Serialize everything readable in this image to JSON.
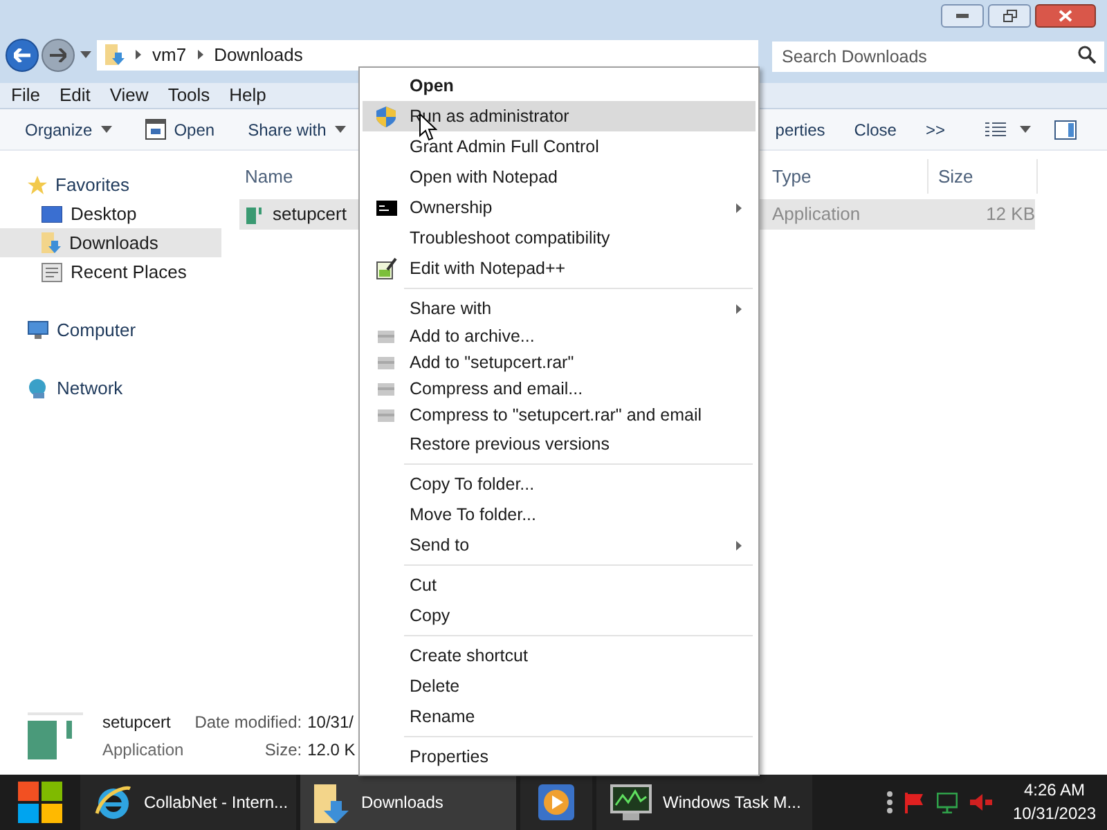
{
  "address_bar": {
    "crumbs": [
      "vm7",
      "Downloads"
    ]
  },
  "search": {
    "placeholder": "Search Downloads"
  },
  "menu_bar": [
    "File",
    "Edit",
    "View",
    "Tools",
    "Help"
  ],
  "toolbar": [
    {
      "label": "Organize",
      "kind": "dropdown"
    },
    {
      "label": "Open",
      "kind": "open"
    },
    {
      "label": "Share with",
      "kind": "dropdown"
    },
    {
      "label": "perties",
      "kind": "plain"
    },
    {
      "label": "Close",
      "kind": "plain"
    },
    {
      "label": ">>",
      "kind": "plain"
    }
  ],
  "sidebar": {
    "items": [
      {
        "label": "Favorites",
        "kind": "star",
        "selected": false
      },
      {
        "label": "Desktop",
        "kind": "desktop",
        "selected": false
      },
      {
        "label": "Downloads",
        "kind": "downloads",
        "selected": true
      },
      {
        "label": "Recent Places",
        "kind": "recent",
        "selected": false
      },
      {
        "label": "Computer",
        "kind": "computer",
        "selected": false
      },
      {
        "label": "Network",
        "kind": "network",
        "selected": false
      }
    ]
  },
  "table": {
    "columns": [
      "Name",
      "Type",
      "Size"
    ],
    "rows": [
      {
        "name": "setupcert",
        "type": "Application",
        "size": "12 KB",
        "selected": true
      }
    ]
  },
  "context_menu": {
    "items": [
      {
        "label": "Open",
        "kind": "default",
        "selected": false,
        "submenu": false
      },
      {
        "label": "Run as administrator",
        "kind": "shield",
        "selected": true,
        "submenu": false
      },
      {
        "label": "Grant Admin Full Control",
        "kind": "plain",
        "selected": false,
        "submenu": false
      },
      {
        "label": "Open with Notepad",
        "kind": "plain",
        "selected": false,
        "submenu": false
      },
      {
        "label": "Ownership",
        "kind": "console",
        "selected": false,
        "submenu": true
      },
      {
        "label": "Troubleshoot compatibility",
        "kind": "plain",
        "selected": false,
        "submenu": false
      },
      {
        "label": "Edit with Notepad++",
        "kind": "notepad",
        "selected": false,
        "submenu": false
      },
      {
        "kind": "separator"
      },
      {
        "label": "Share with",
        "kind": "plain",
        "selected": false,
        "submenu": true
      },
      {
        "label": "Add to archive...",
        "kind": "archive",
        "selected": false,
        "submenu": false
      },
      {
        "label": "Add to \"setupcert.rar\"",
        "kind": "archive",
        "selected": false,
        "submenu": false
      },
      {
        "label": "Compress and email...",
        "kind": "archive",
        "selected": false,
        "submenu": false
      },
      {
        "label": "Compress to \"setupcert.rar\" and email",
        "kind": "archive",
        "selected": false,
        "submenu": false
      },
      {
        "label": "Restore previous versions",
        "kind": "plain",
        "selected": false,
        "submenu": false
      },
      {
        "kind": "separator"
      },
      {
        "label": "Copy To folder...",
        "kind": "plain",
        "selected": false,
        "submenu": false
      },
      {
        "label": "Move To folder...",
        "kind": "plain",
        "selected": false,
        "submenu": false
      },
      {
        "label": "Send to",
        "kind": "plain",
        "selected": false,
        "submenu": true
      },
      {
        "kind": "separator"
      },
      {
        "label": "Cut",
        "kind": "plain",
        "selected": false,
        "submenu": false
      },
      {
        "label": "Copy",
        "kind": "plain",
        "selected": false,
        "submenu": false
      },
      {
        "kind": "separator"
      },
      {
        "label": "Create shortcut",
        "kind": "plain",
        "selected": false,
        "submenu": false
      },
      {
        "label": "Delete",
        "kind": "plain",
        "selected": false,
        "submenu": false
      },
      {
        "label": "Rename",
        "kind": "plain",
        "selected": false,
        "submenu": false
      },
      {
        "kind": "separator"
      },
      {
        "label": "Properties",
        "kind": "plain",
        "selected": false,
        "submenu": false
      }
    ]
  },
  "details_pane": {
    "name": "setupcert",
    "type": "Application",
    "date_label": "Date modified:",
    "date_value": "10/31/",
    "size_label": "Size:",
    "size_value": "12.0 K"
  },
  "taskbar": {
    "buttons": [
      {
        "label": "CollabNet - Intern...",
        "kind": "browser",
        "selected": false
      },
      {
        "label": "Downloads",
        "kind": "folder",
        "selected": true
      },
      {
        "kind": "media",
        "selected": false
      },
      {
        "label": "Windows Task M...",
        "kind": "taskmgr",
        "selected": false
      }
    ],
    "time": "4:26 AM",
    "date": "10/31/2023"
  }
}
